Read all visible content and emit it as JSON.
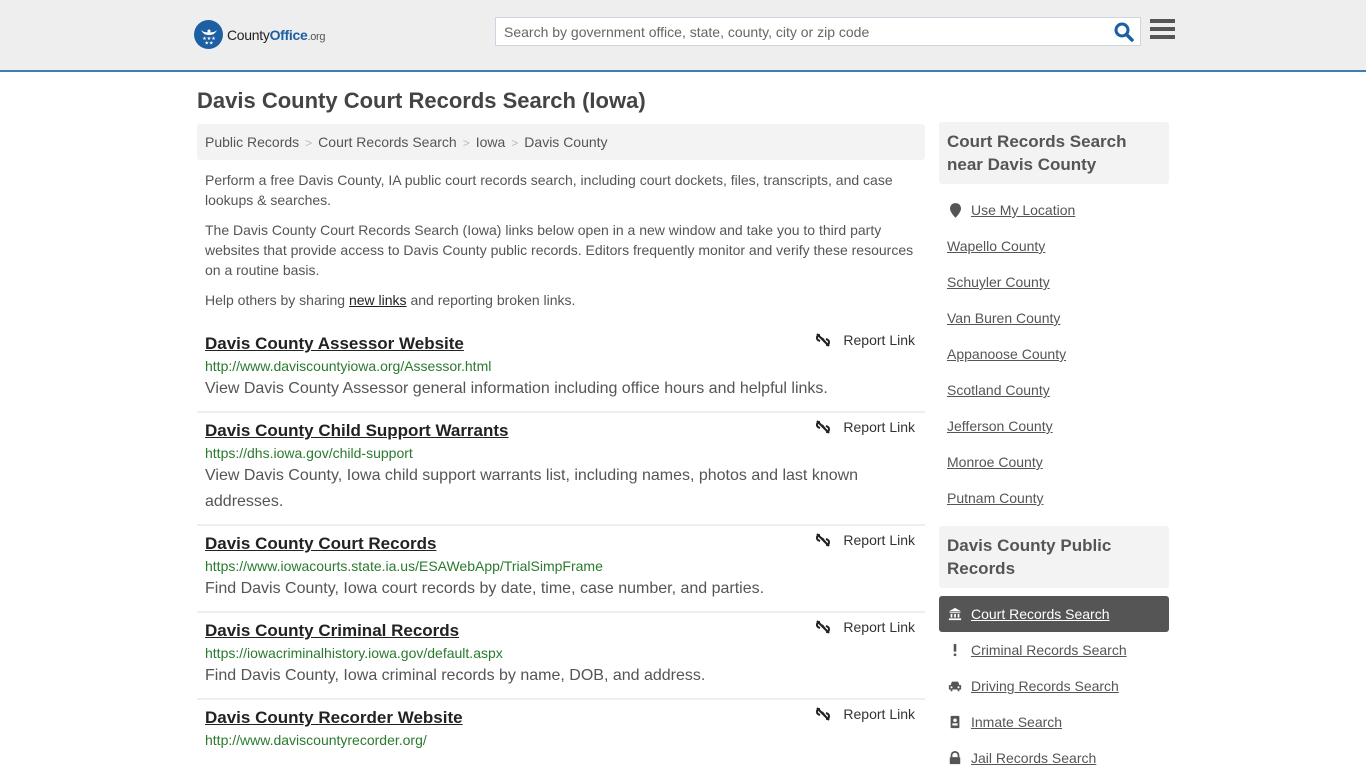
{
  "header": {
    "logo": {
      "name_part1": "County",
      "name_part2": "Office",
      "name_part3": ".org"
    },
    "search": {
      "placeholder": "Search by government office, state, county, city or zip code",
      "value": ""
    },
    "icons": {
      "search": "search-icon",
      "menu": "hamburger-menu-icon"
    }
  },
  "page": {
    "title": "Davis County Court Records Search (Iowa)",
    "breadcrumb": [
      "Public Records",
      "Court Records Search",
      "Iowa",
      "Davis County"
    ],
    "intro": {
      "p1": "Perform a free Davis County, IA public court records search, including court dockets, files, transcripts, and case lookups & searches.",
      "p2": "The Davis County Court Records Search (Iowa) links below open in a new window and take you to third party websites that provide access to Davis County public records. Editors frequently monitor and verify these resources on a routine basis.",
      "p3_before": "Help others by sharing ",
      "p3_link": "new links",
      "p3_after": " and reporting broken links."
    },
    "report_label": "Report Link",
    "links": [
      {
        "title": "Davis County Assessor Website",
        "url": "http://www.daviscountyiowa.org/Assessor.html",
        "desc": "View Davis County Assessor general information including office hours and helpful links."
      },
      {
        "title": "Davis County Child Support Warrants",
        "url": "https://dhs.iowa.gov/child-support",
        "desc": "View Davis County, Iowa child support warrants list, including names, photos and last known addresses."
      },
      {
        "title": "Davis County Court Records",
        "url": "https://www.iowacourts.state.ia.us/ESAWebApp/TrialSimpFrame",
        "desc": "Find Davis County, Iowa court records by date, time, case number, and parties."
      },
      {
        "title": "Davis County Criminal Records",
        "url": "https://iowacriminalhistory.iowa.gov/default.aspx",
        "desc": "Find Davis County, Iowa criminal records by name, DOB, and address."
      },
      {
        "title": "Davis County Recorder Website",
        "url": "http://www.daviscountyrecorder.org/",
        "desc": ""
      }
    ]
  },
  "sidebar": {
    "nearby": {
      "heading": "Court Records Search near Davis County",
      "use_location": "Use My Location",
      "counties": [
        "Wapello County",
        "Schuyler County",
        "Van Buren County",
        "Appanoose County",
        "Scotland County",
        "Jefferson County",
        "Monroe County",
        "Putnam County"
      ]
    },
    "public_records": {
      "heading": "Davis County Public Records",
      "items": [
        {
          "label": "Court Records Search",
          "icon": "courthouse-icon",
          "active": true
        },
        {
          "label": "Criminal Records Search",
          "icon": "exclamation-icon",
          "active": false
        },
        {
          "label": "Driving Records Search",
          "icon": "car-icon",
          "active": false
        },
        {
          "label": "Inmate Search",
          "icon": "id-badge-icon",
          "active": false
        },
        {
          "label": "Jail Records Search",
          "icon": "lock-icon",
          "active": false
        }
      ]
    }
  },
  "colors": {
    "brand_blue": "#1d5fa3",
    "header_border": "#3a7fb3",
    "url_green": "#2a7a2e",
    "active_bg": "#555555"
  }
}
